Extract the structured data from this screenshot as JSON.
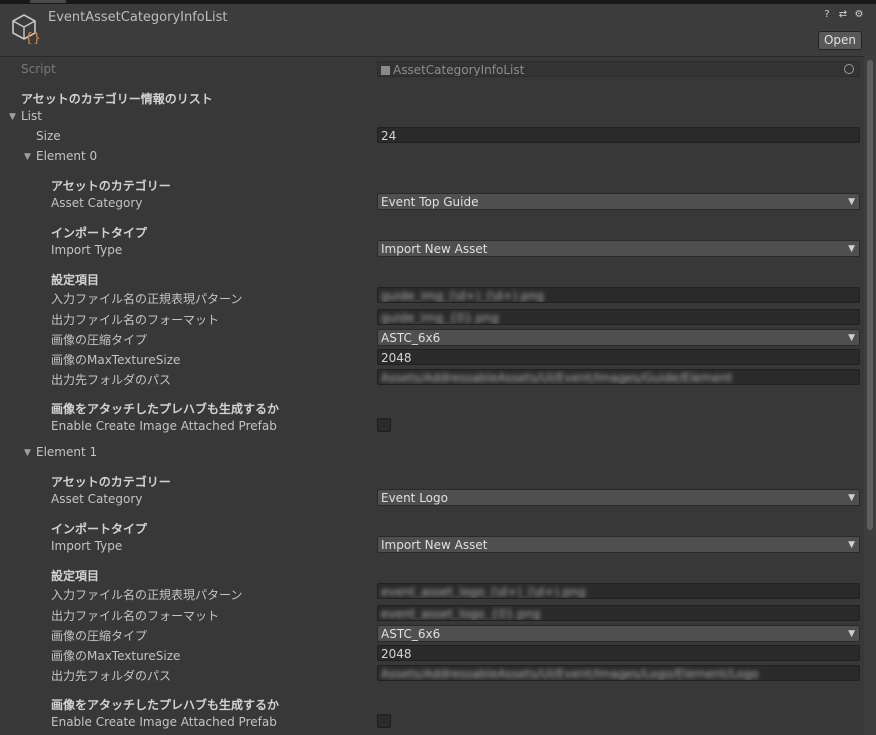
{
  "window": {
    "title": "EventAssetCategoryInfoList",
    "open_label": "Open"
  },
  "script": {
    "label": "Script",
    "value": "AssetCategoryInfoList"
  },
  "list_header": "アセットのカテゴリー情報のリスト",
  "list": {
    "label": "List",
    "size_label": "Size",
    "size_value": "24"
  },
  "labels": {
    "category_header": "アセットのカテゴリー",
    "category": "Asset Category",
    "import_header": "インポートタイプ",
    "import_type": "Import Type",
    "settings_header": "設定項目",
    "input_regex": "入力ファイル名の正規表現パターン",
    "output_format": "出力ファイル名のフォーマット",
    "compression": "画像の圧縮タイプ",
    "max_texture": "画像のMaxTextureSize",
    "output_folder": "出力先フォルダのパス",
    "prefab_header": "画像をアタッチしたプレハブも生成するか",
    "prefab": "Enable Create Image Attached Prefab"
  },
  "elements": [
    {
      "name": "Element 0",
      "asset_category": "Event Top Guide",
      "import_type": "Import New Asset",
      "input_regex": "guide_img_(\\d+)_(\\d+).png",
      "output_format": "guide_img_{0}.png",
      "compression": "ASTC_6x6",
      "max_texture": "2048",
      "output_folder": "Assets/AddressableAssets/UI/Event/Images/Guide/Element"
    },
    {
      "name": "Element 1",
      "asset_category": "Event Logo",
      "import_type": "Import New Asset",
      "input_regex": "event_asset_logo_(\\d+)_(\\d+).png",
      "output_format": "event_asset_logo_{0}.png",
      "compression": "ASTC_6x6",
      "max_texture": "2048",
      "output_folder": "Assets/AddressableAssets/UI/Event/Images/Logo/Element/Logo"
    }
  ]
}
